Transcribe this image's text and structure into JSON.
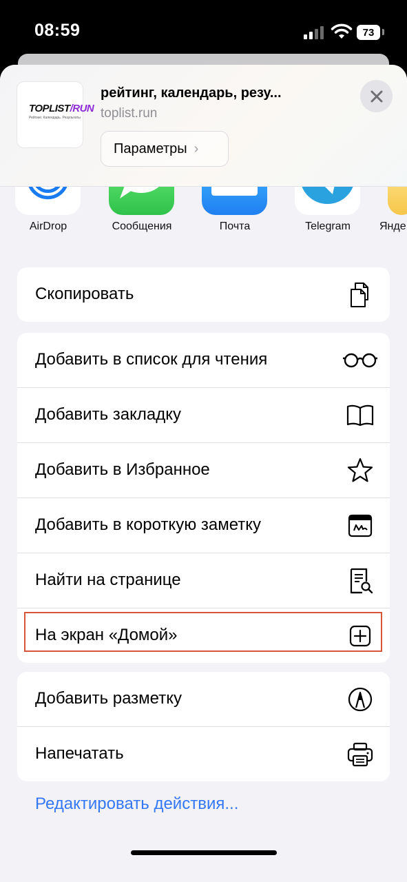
{
  "status_bar": {
    "time": "08:59",
    "battery": "73"
  },
  "header": {
    "logo_text": "TOPLIST",
    "logo_sep": "/",
    "logo_run": "RUN",
    "logo_sub": "Рейтинг. Календарь. Результаты",
    "title": "рейтинг, календарь, резу...",
    "url": "toplist.run",
    "params_label": "Параметры"
  },
  "apps": [
    {
      "label": "AirDrop",
      "icon": "airdrop-icon"
    },
    {
      "label": "Сообщения",
      "icon": "messages-icon"
    },
    {
      "label": "Почта",
      "icon": "mail-icon"
    },
    {
      "label": "Telegram",
      "icon": "telegram-icon"
    },
    {
      "label": "Янде",
      "icon": "yandex-icon"
    }
  ],
  "actions": {
    "copy": "Скопировать",
    "reading_list": "Добавить в список для чтения",
    "bookmark": "Добавить закладку",
    "favorites": "Добавить в Избранное",
    "quick_note": "Добавить в короткую заметку",
    "find": "Найти на странице",
    "home_screen": "На экран «Домой»",
    "markup": "Добавить разметку",
    "print": "Напечатать"
  },
  "edit_actions": "Редактировать действия...",
  "colors": {
    "accent": "#3478f6",
    "highlight": "#d9553a",
    "sheet_bg": "#f2f2f7"
  }
}
